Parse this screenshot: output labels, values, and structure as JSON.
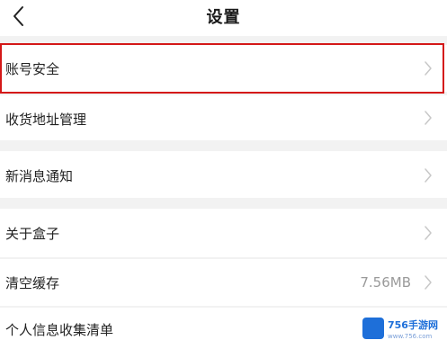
{
  "header": {
    "title": "设置",
    "back_icon": "chevron-left-icon"
  },
  "settings": {
    "account_security": "账号安全",
    "address_management": "收货地址管理",
    "new_message_notify": "新消息通知",
    "about_box": "关于盒子",
    "clear_cache": "清空缓存",
    "cache_size": "7.56MB",
    "personal_info_list": "个人信息收集清单"
  },
  "highlight_color": "#d41818",
  "watermark": {
    "text": "756手游网",
    "sub": "www.756.com"
  }
}
